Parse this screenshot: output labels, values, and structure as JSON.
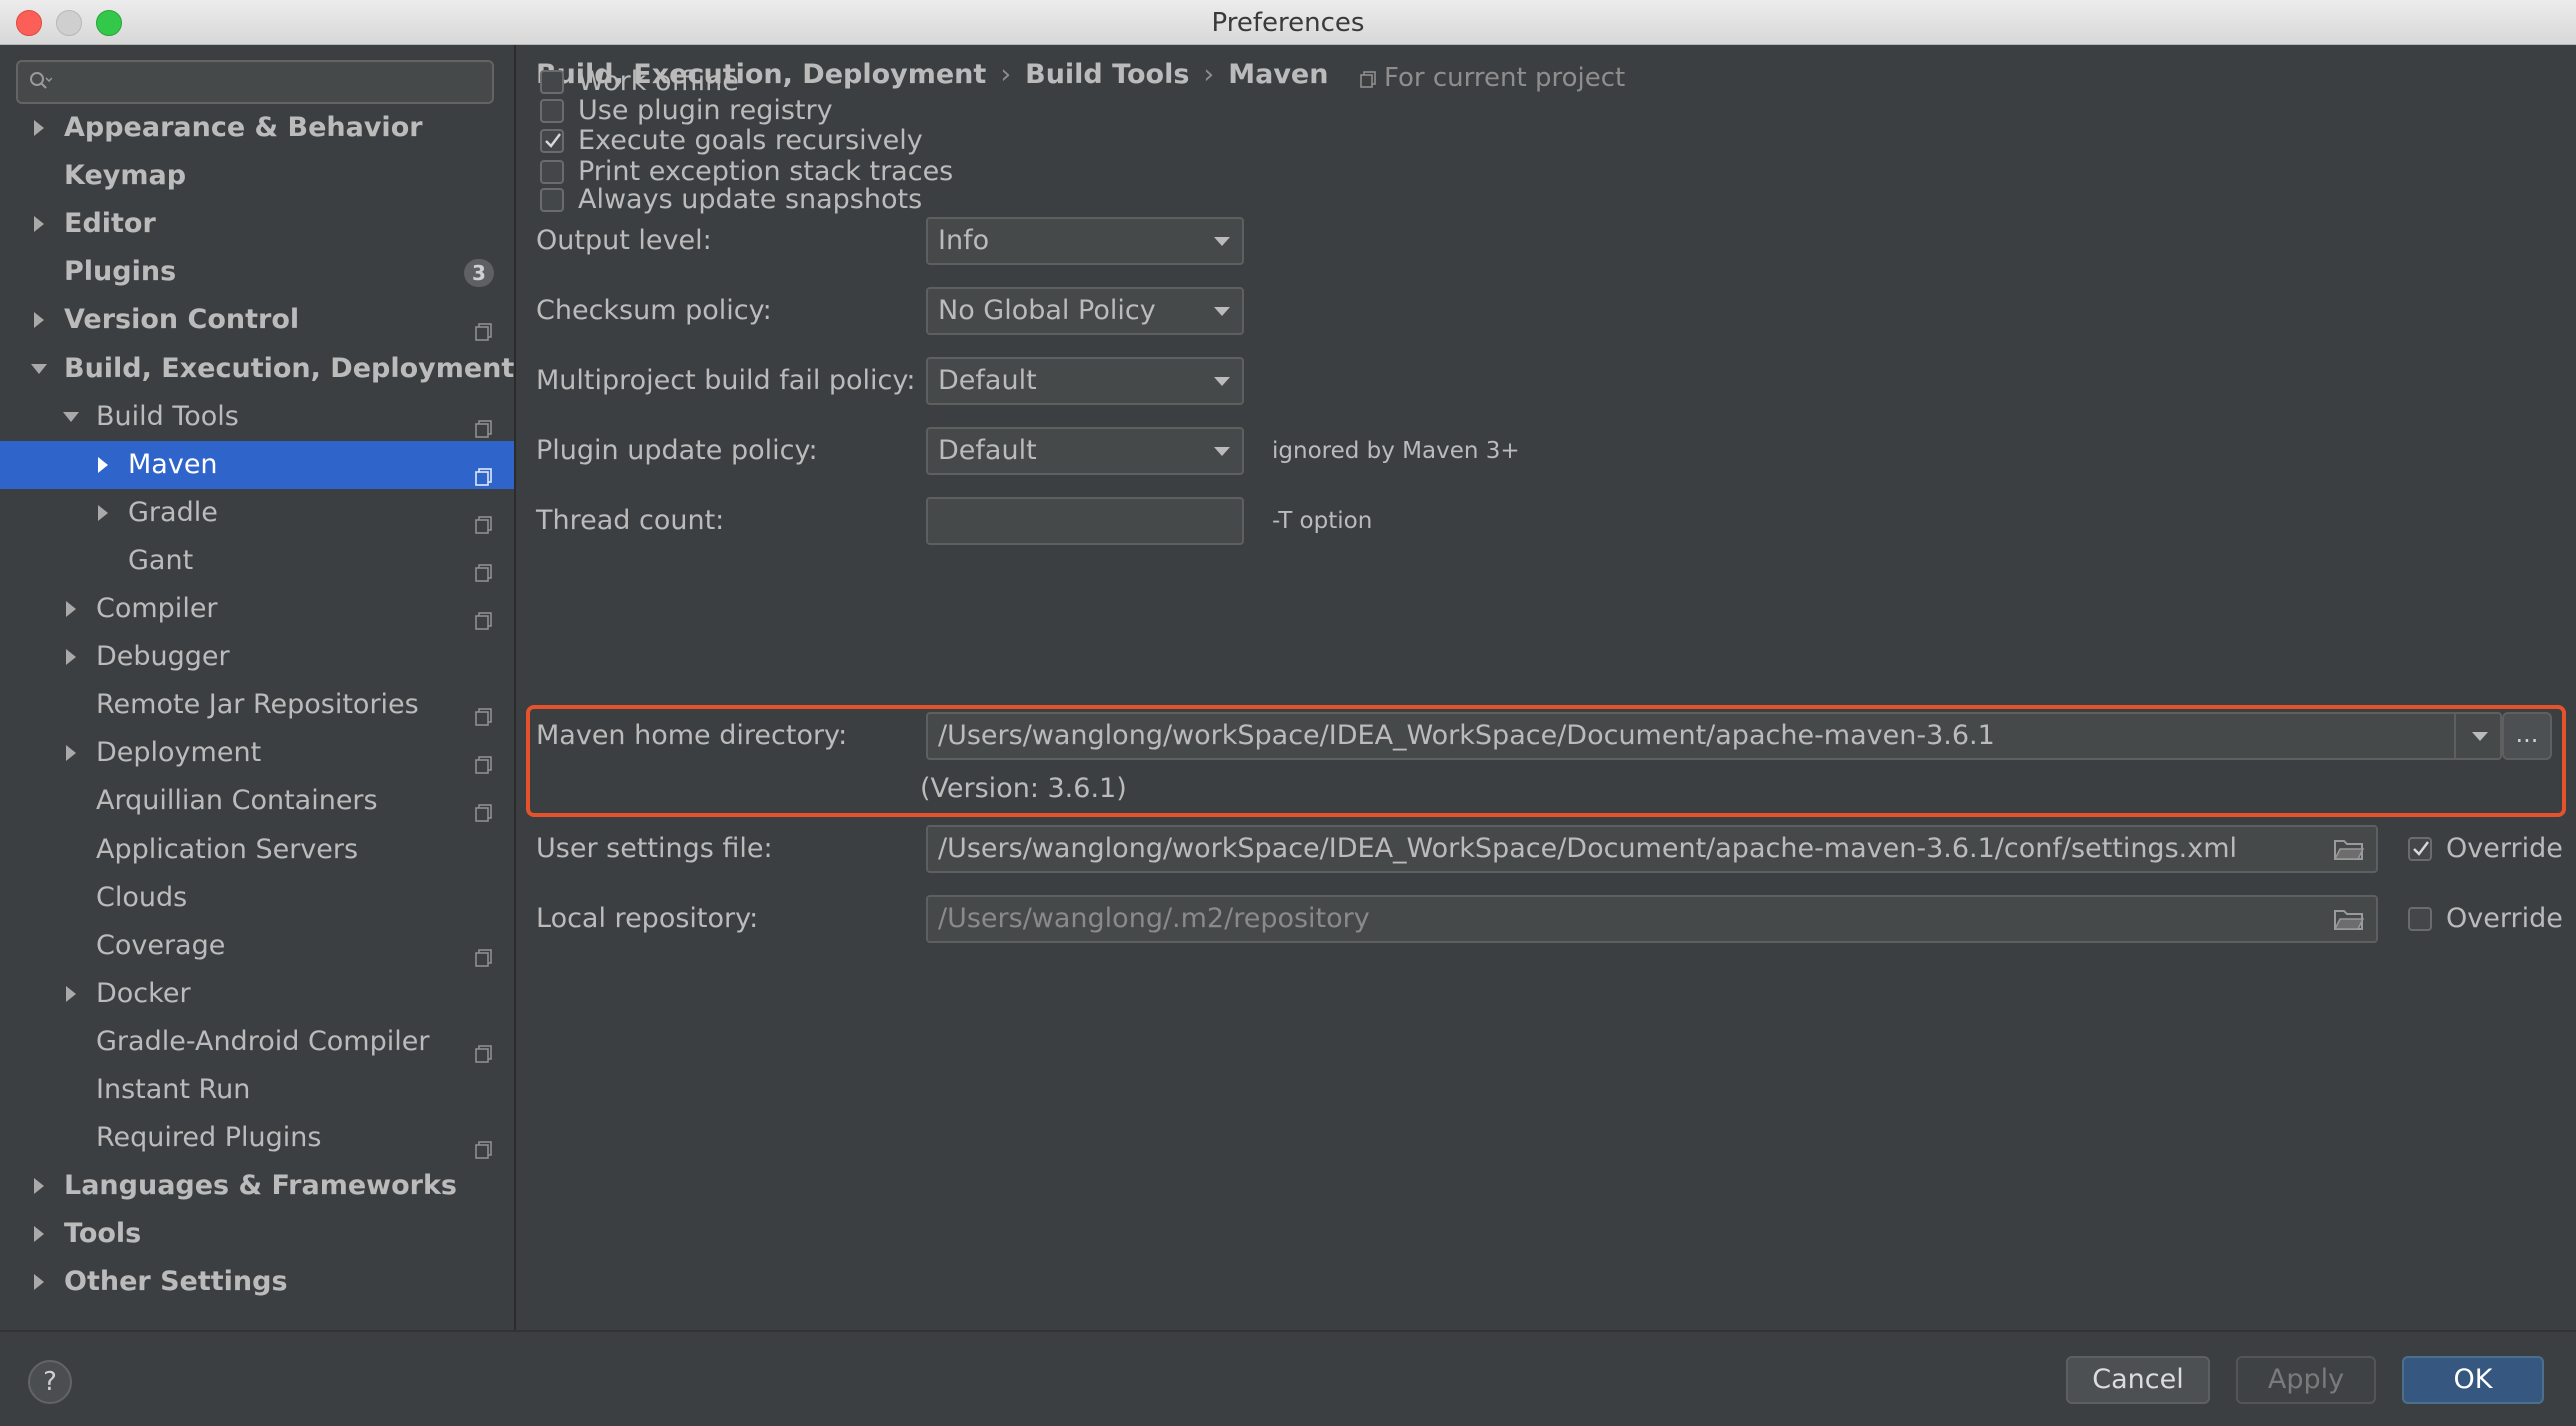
{
  "window": {
    "title": "Preferences"
  },
  "search": {
    "placeholder": ""
  },
  "sidebar": {
    "items": [
      {
        "label": "Appearance & Behavior",
        "bold": true,
        "arrow": "right",
        "level": 0
      },
      {
        "label": "Keymap",
        "bold": true,
        "arrow": "",
        "level": 0
      },
      {
        "label": "Editor",
        "bold": true,
        "arrow": "right",
        "level": 0
      },
      {
        "label": "Plugins",
        "bold": true,
        "arrow": "",
        "level": 0,
        "badge": "3"
      },
      {
        "label": "Version Control",
        "bold": true,
        "arrow": "right",
        "level": 0,
        "proj": true
      },
      {
        "label": "Build, Execution, Deployment",
        "bold": true,
        "arrow": "down",
        "level": 0
      },
      {
        "label": "Build Tools",
        "bold": false,
        "arrow": "down",
        "level": 1,
        "proj": true
      },
      {
        "label": "Maven",
        "bold": false,
        "arrow": "right",
        "level": 2,
        "proj": true,
        "selected": true
      },
      {
        "label": "Gradle",
        "bold": false,
        "arrow": "right",
        "level": 2,
        "proj": true
      },
      {
        "label": "Gant",
        "bold": false,
        "arrow": "",
        "level": 2,
        "proj": true
      },
      {
        "label": "Compiler",
        "bold": false,
        "arrow": "right",
        "level": 1,
        "proj": true
      },
      {
        "label": "Debugger",
        "bold": false,
        "arrow": "right",
        "level": 1
      },
      {
        "label": "Remote Jar Repositories",
        "bold": false,
        "arrow": "",
        "level": 1,
        "proj": true
      },
      {
        "label": "Deployment",
        "bold": false,
        "arrow": "right",
        "level": 1,
        "proj": true
      },
      {
        "label": "Arquillian Containers",
        "bold": false,
        "arrow": "",
        "level": 1,
        "proj": true
      },
      {
        "label": "Application Servers",
        "bold": false,
        "arrow": "",
        "level": 1
      },
      {
        "label": "Clouds",
        "bold": false,
        "arrow": "",
        "level": 1
      },
      {
        "label": "Coverage",
        "bold": false,
        "arrow": "",
        "level": 1,
        "proj": true
      },
      {
        "label": "Docker",
        "bold": false,
        "arrow": "right",
        "level": 1
      },
      {
        "label": "Gradle-Android Compiler",
        "bold": false,
        "arrow": "",
        "level": 1,
        "proj": true
      },
      {
        "label": "Instant Run",
        "bold": false,
        "arrow": "",
        "level": 1
      },
      {
        "label": "Required Plugins",
        "bold": false,
        "arrow": "",
        "level": 1,
        "proj": true
      },
      {
        "label": "Languages & Frameworks",
        "bold": true,
        "arrow": "right",
        "level": 0
      },
      {
        "label": "Tools",
        "bold": true,
        "arrow": "right",
        "level": 0
      },
      {
        "label": "Other Settings",
        "bold": true,
        "arrow": "right",
        "level": 0
      }
    ]
  },
  "breadcrumb": {
    "part1": "Build, Execution, Deployment",
    "sep": "›",
    "part2": "Build Tools",
    "part3": "Maven"
  },
  "for_current_project": "For current project",
  "checkboxes": [
    {
      "label": "Work offline",
      "checked": false
    },
    {
      "label": "Use plugin registry",
      "checked": false
    },
    {
      "label": "Execute goals recursively",
      "checked": true
    },
    {
      "label": "Print exception stack traces",
      "checked": false
    },
    {
      "label": "Always update snapshots",
      "checked": false
    }
  ],
  "fields": {
    "output_level": {
      "label": "Output level:",
      "value": "Info"
    },
    "checksum_policy": {
      "label": "Checksum policy:",
      "value": "No Global Policy"
    },
    "multiproject_fail_policy": {
      "label": "Multiproject build fail policy:",
      "value": "Default"
    },
    "plugin_update_policy": {
      "label": "Plugin update policy:",
      "value": "Default",
      "hint": "ignored by Maven 3+"
    },
    "thread_count": {
      "label": "Thread count:",
      "value": "",
      "hint": "-T option"
    },
    "maven_home": {
      "label": "Maven home directory:",
      "value": "/Users/wanglong/workSpace/IDEA_WorkSpace/Document/apache-maven-3.6.1",
      "browse": "...",
      "version": "(Version: 3.6.1)"
    },
    "user_settings": {
      "label": "User settings file:",
      "value": "/Users/wanglong/workSpace/IDEA_WorkSpace/Document/apache-maven-3.6.1/conf/settings.xml",
      "override_label": "Override",
      "override_checked": true
    },
    "local_repo": {
      "label": "Local repository:",
      "value": "/Users/wanglong/.m2/repository",
      "override_label": "Override",
      "override_checked": false
    }
  },
  "buttons": {
    "help": "?",
    "cancel": "Cancel",
    "apply": "Apply",
    "ok": "OK"
  },
  "colors": {
    "accent": "#2f65ca",
    "highlight": "#e5532d",
    "ok_button": "#365880"
  }
}
